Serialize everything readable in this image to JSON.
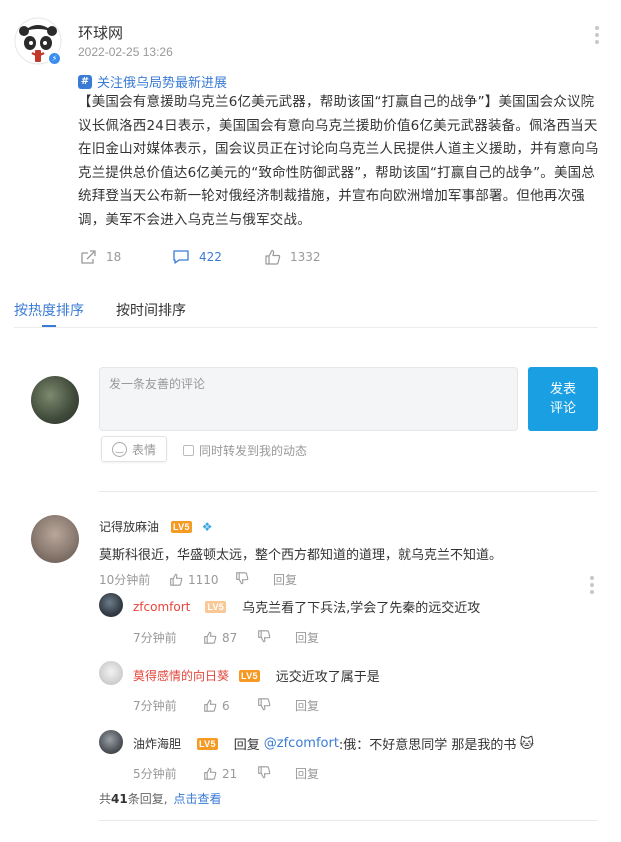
{
  "post": {
    "author": "环球网",
    "time": "2022-02-25 13:26",
    "topic": "关注俄乌局势最新进展",
    "topic_icon": "#",
    "content": "【美国会有意援助乌克兰6亿美元武器，帮助该国“打赢自己的战争”】美国国会众议院议长佩洛西24日表示，美国国会有意向乌克兰援助价值6亿美元武器装备。佩洛西当天在旧金山对媒体表示，国会议员正在讨论向乌克兰人民提供人道主义援助，并有意向乌克兰提供总价值达6亿美元的“致命性防御武器”，帮助该国“打赢自己的战争”。美国总统拜登当天公布新一轮对俄经济制裁措施，并宣布向欧洲增加军事部署。但他再次强调，美军不会进入乌克兰与俄军交战。",
    "shares": "18",
    "comments": "422",
    "likes": "1332"
  },
  "sort_tabs": {
    "hot": "按热度排序",
    "time": "按时间排序"
  },
  "composer": {
    "placeholder": "发一条友善的评论",
    "submit_line1": "发表",
    "submit_line2": "评论",
    "emoji_label": "表情",
    "repost_label": "同时转发到我的动态"
  },
  "comments": [
    {
      "user": "记得放麻油",
      "level": "LV5",
      "text": "莫斯科很近，华盛顿太远，整个西方都知道的道理，就乌克兰不知道。",
      "time": "10分钟前",
      "likes": "1110",
      "reply_label": "回复"
    }
  ],
  "replies": [
    {
      "user": "zfcomfort",
      "level": "LV5",
      "text": "乌克兰看了下兵法,学会了先秦的远交近攻",
      "time": "7分钟前",
      "likes": "87",
      "reply_label": "回复"
    },
    {
      "user": "莫得感情的向日葵",
      "level": "LV5",
      "text": "远交近攻了属于是",
      "time": "7分钟前",
      "likes": "6",
      "reply_label": "回复"
    },
    {
      "user": "油炸海胆",
      "level": "LV5",
      "reply_prefix": "回复",
      "mention": "@zfcomfort",
      "text": " :俄：不好意思同学 那是我的书",
      "time": "5分钟前",
      "likes": "21",
      "reply_label": "回复"
    }
  ],
  "total_replies": {
    "prefix": "共",
    "count": "41",
    "suffix": "条回复,",
    "link": "点击查看"
  },
  "colors": {
    "accent": "#3a7bd5",
    "submit": "#1a9fe3",
    "level_badge": "#f59a23"
  }
}
